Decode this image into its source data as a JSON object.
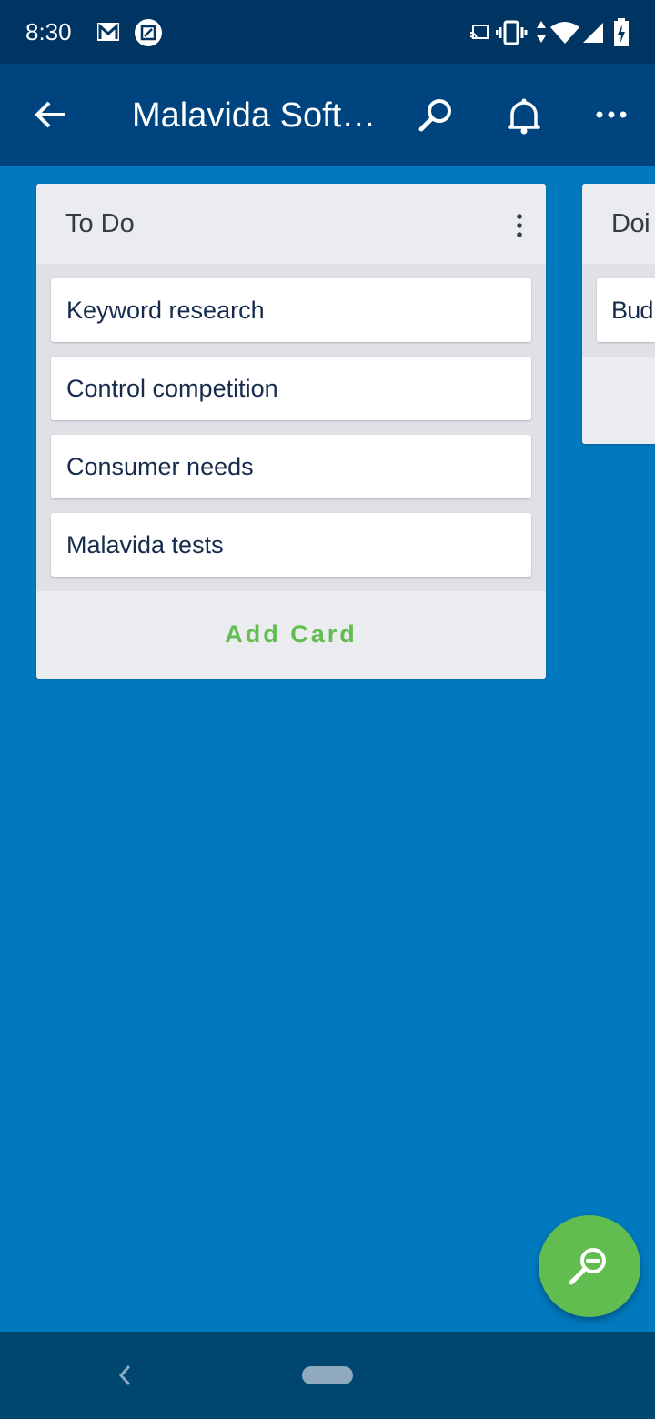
{
  "status_bar": {
    "time": "8:30",
    "icons": [
      "gmail-icon",
      "screenshot-edit-icon",
      "cast-icon",
      "vibrate-icon",
      "data-arrows-icon",
      "wifi-icon",
      "signal-icon",
      "battery-charging-icon"
    ]
  },
  "app_bar": {
    "title": "Malavida Soft…",
    "icons": [
      "back-arrow-icon",
      "search-icon",
      "bell-icon",
      "more-horizontal-icon"
    ]
  },
  "lists": [
    {
      "name": "To Do",
      "cards": [
        "Keyword research",
        "Control competition",
        "Consumer needs",
        "Malavida tests"
      ],
      "add_label": "Add Card"
    },
    {
      "name": "Doi",
      "cards": [
        "Bud"
      ]
    }
  ],
  "fab": {
    "icon": "zoom-out-icon"
  },
  "colors": {
    "status_bar": "#003462",
    "app_bar": "#00447f",
    "board": "#0079bf",
    "accent_green": "#61bd4f",
    "nav_bar": "#00476f"
  }
}
